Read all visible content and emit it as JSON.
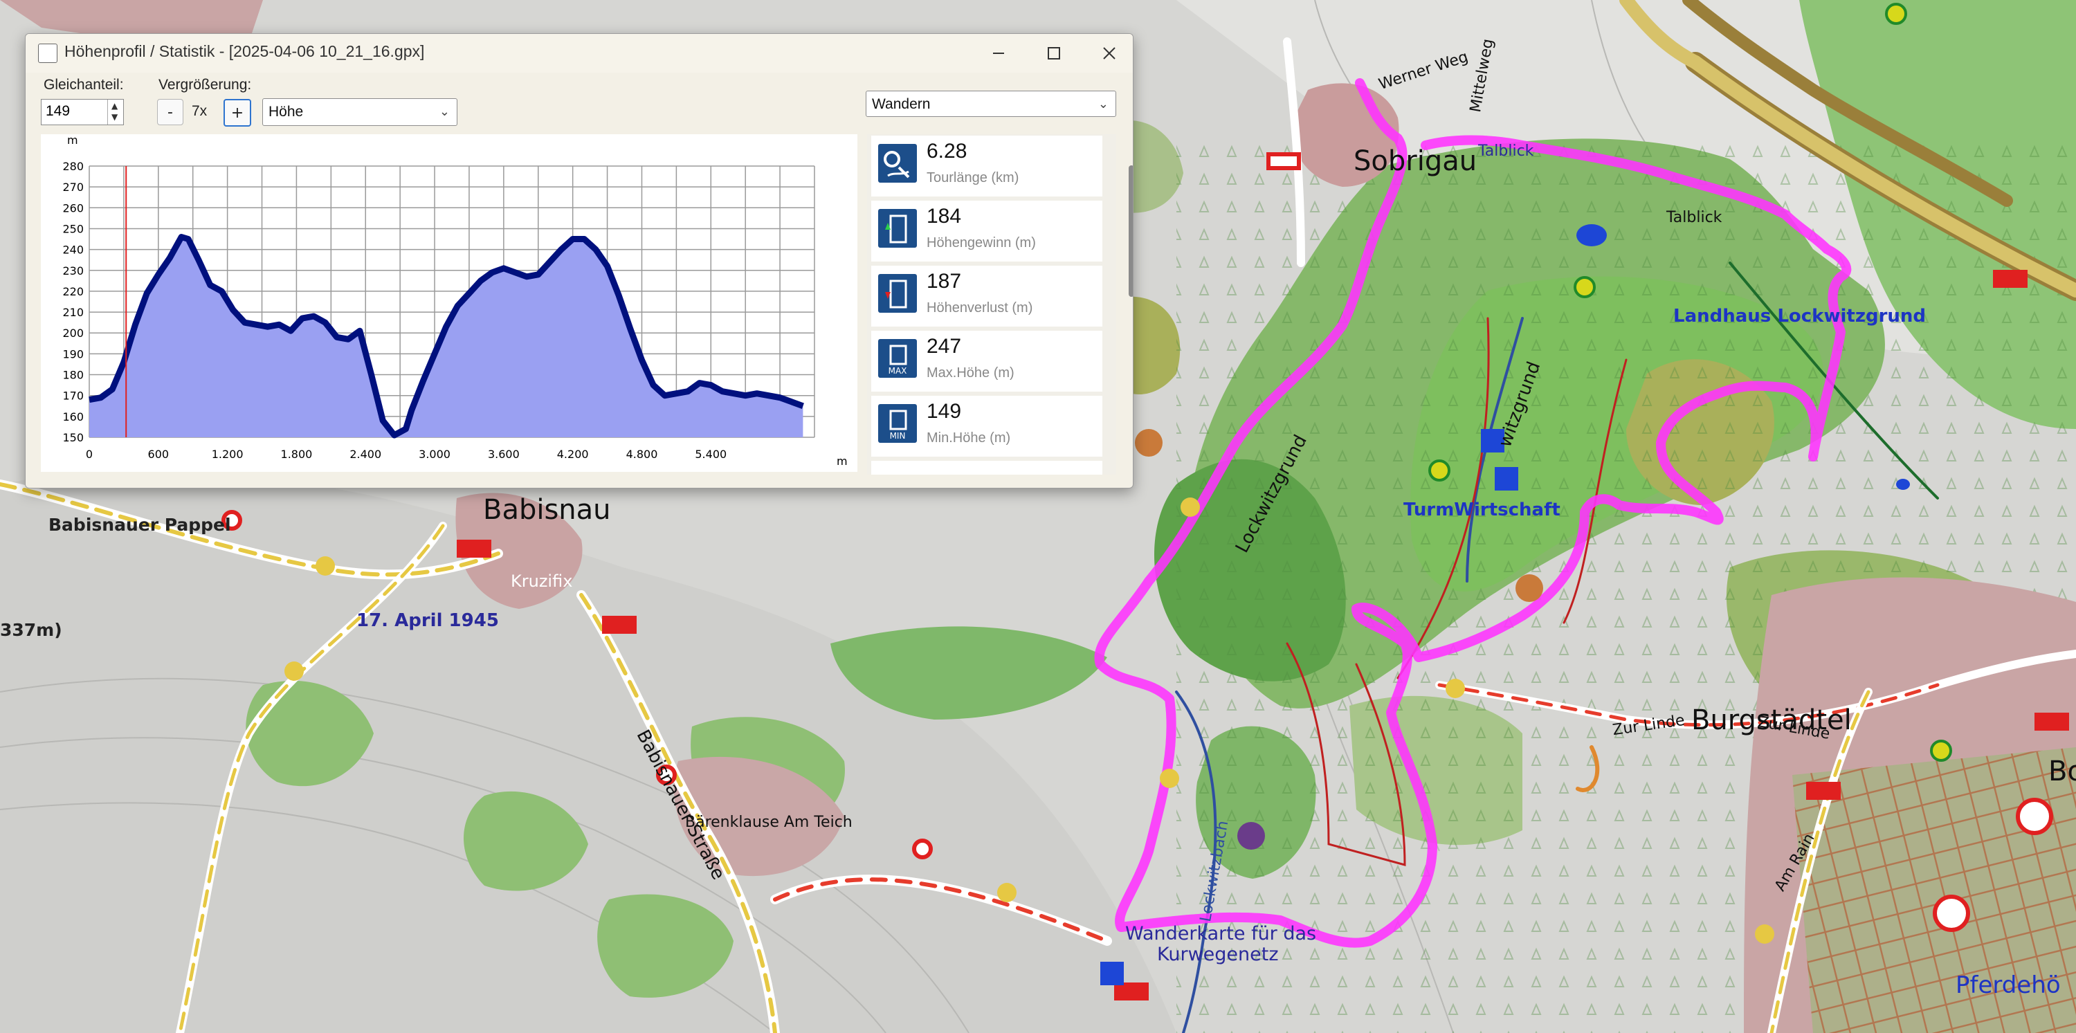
{
  "window": {
    "title": "Höhenprofil / Statistik - [2025-04-06 10_21_16.gpx]",
    "offset_label": "Gleichanteil:",
    "offset_value": "149",
    "zoom_label": "Vergrößerung:",
    "zoom_minus": "-",
    "zoom_value": "7x",
    "zoom_plus": "+",
    "profile_type": "Höhe",
    "activity": "Wandern",
    "minimize_icon": "minimize-icon",
    "maximize_icon": "maximize-icon",
    "close_icon": "close-icon"
  },
  "chart_data": {
    "type": "area",
    "ylabel": "m",
    "xlabel": "m",
    "xlim": [
      0,
      6300
    ],
    "ylim": [
      150,
      280
    ],
    "xticks": [
      "0",
      "600",
      "1.200",
      "1.800",
      "2.400",
      "3.000",
      "3.600",
      "4.200",
      "4.800",
      "5.400"
    ],
    "yticks": [
      "150",
      "160",
      "170",
      "180",
      "190",
      "200",
      "210",
      "220",
      "230",
      "240",
      "250",
      "260",
      "270",
      "280"
    ],
    "marker_x": 320,
    "series": [
      {
        "x": [
          0,
          100,
          200,
          300,
          400,
          500,
          600,
          700,
          800,
          860,
          950,
          1050,
          1150,
          1250,
          1350,
          1450,
          1550,
          1650,
          1750,
          1850,
          1950,
          2050,
          2150,
          2250,
          2350,
          2450,
          2550,
          2650,
          2750,
          2800,
          2900,
          3000,
          3100,
          3200,
          3300,
          3400,
          3500,
          3600,
          3700,
          3800,
          3900,
          4000,
          4100,
          4200,
          4300,
          4400,
          4500,
          4600,
          4700,
          4800,
          4900,
          5000,
          5100,
          5200,
          5300,
          5400,
          5500,
          5600,
          5700,
          5800,
          5900,
          6000,
          6100,
          6200
        ],
        "y": [
          168,
          169,
          173,
          186,
          204,
          219,
          228,
          236,
          246,
          245,
          235,
          223,
          220,
          211,
          205,
          204,
          203,
          204,
          201,
          207,
          208,
          205,
          198,
          197,
          201,
          180,
          158,
          151,
          154,
          163,
          177,
          190,
          203,
          213,
          219,
          225,
          229,
          231,
          229,
          227,
          228,
          234,
          240,
          245,
          245,
          240,
          232,
          218,
          202,
          187,
          175,
          170,
          171,
          172,
          176,
          175,
          172,
          171,
          170,
          171,
          170,
          169,
          167,
          165
        ]
      }
    ]
  },
  "stats": [
    {
      "icon": "distance-icon",
      "value": "6.28",
      "label": "Tourlänge (km)"
    },
    {
      "icon": "elevation-gain-icon",
      "value": "184",
      "label": "Höhengewinn (m)"
    },
    {
      "icon": "elevation-loss-icon",
      "value": "187",
      "label": "Höhenverlust (m)"
    },
    {
      "icon": "max-height-icon",
      "value": "247",
      "label": "Max.Höhe (m)",
      "badge": "MAX"
    },
    {
      "icon": "min-height-icon",
      "value": "149",
      "label": "Min.Höhe (m)",
      "badge": "MIN"
    }
  ],
  "map": {
    "labels": {
      "sobrigau": "Sobrigau",
      "babisnau": "Babisnau",
      "burgstaedtel": "Burgstädtel",
      "pferdeho": "Pferdehö",
      "bo": "Bo",
      "babisnauer_pappel": "Babisnauer Pappel",
      "kruzifix": "Kruzifix",
      "april": "17. April 1945",
      "m337": "337m)",
      "landhaus": "Landhaus Lockwitzgrund",
      "turmwirtschaft": "TurmWirtschaft",
      "lockwitzgrund": "Lockwitzgrund",
      "witzgrund": "witzgrund",
      "talblick1": "Talblick",
      "talblick2": "Talblick",
      "werner_weg": "Werner Weg",
      "mittelweg": "Mittelweg",
      "zur_linde1": "Zur Linde",
      "zur_linde2": "Zur Linde",
      "baerenklause": "Bärenklause Am Teich",
      "babisnauer_strasse": "Babisnauer Straße",
      "lockwitzbach": "Lockwitzbach",
      "kurwege": "Wanderkarte für das",
      "kurwege2": "Kurwegenetz",
      "am_rain": "Am Rain"
    }
  }
}
